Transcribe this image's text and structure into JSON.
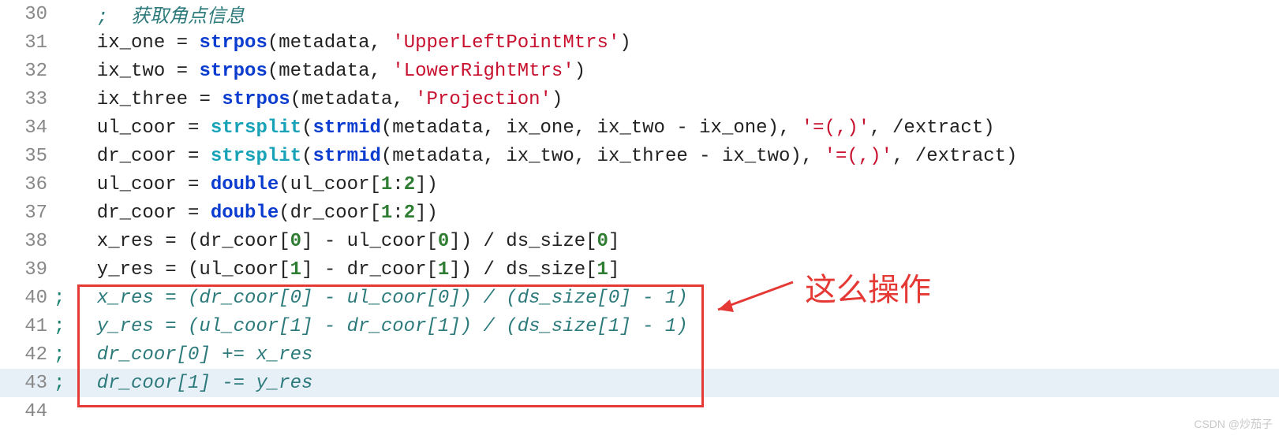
{
  "lines": [
    {
      "num": "30",
      "mod": "",
      "kind": "comment",
      "text": "  ;  获取角点信息"
    },
    {
      "num": "31",
      "mod": "",
      "kind": "code",
      "tokens": [
        {
          "t": "id",
          "v": "  ix_one "
        },
        {
          "t": "op",
          "v": "= "
        },
        {
          "t": "kw",
          "v": "strpos"
        },
        {
          "t": "op",
          "v": "(metadata, "
        },
        {
          "t": "str",
          "v": "'UpperLeftPointMtrs'"
        },
        {
          "t": "op",
          "v": ")"
        }
      ]
    },
    {
      "num": "32",
      "mod": "",
      "kind": "code",
      "tokens": [
        {
          "t": "id",
          "v": "  ix_two "
        },
        {
          "t": "op",
          "v": "= "
        },
        {
          "t": "kw",
          "v": "strpos"
        },
        {
          "t": "op",
          "v": "(metadata, "
        },
        {
          "t": "str",
          "v": "'LowerRightMtrs'"
        },
        {
          "t": "op",
          "v": ")"
        }
      ]
    },
    {
      "num": "33",
      "mod": "",
      "kind": "code",
      "tokens": [
        {
          "t": "id",
          "v": "  ix_three "
        },
        {
          "t": "op",
          "v": "= "
        },
        {
          "t": "kw",
          "v": "strpos"
        },
        {
          "t": "op",
          "v": "(metadata, "
        },
        {
          "t": "str",
          "v": "'Projection'"
        },
        {
          "t": "op",
          "v": ")"
        }
      ]
    },
    {
      "num": "34",
      "mod": "",
      "kind": "code",
      "tokens": [
        {
          "t": "id",
          "v": "  ul_coor "
        },
        {
          "t": "op",
          "v": "= "
        },
        {
          "t": "kw-cyan",
          "v": "strsplit"
        },
        {
          "t": "op",
          "v": "("
        },
        {
          "t": "kw",
          "v": "strmid"
        },
        {
          "t": "op",
          "v": "(metadata, ix_one, ix_two - ix_one), "
        },
        {
          "t": "str",
          "v": "'=(,)'"
        },
        {
          "t": "op",
          "v": ", /extract)"
        }
      ]
    },
    {
      "num": "35",
      "mod": "",
      "kind": "code",
      "tokens": [
        {
          "t": "id",
          "v": "  dr_coor "
        },
        {
          "t": "op",
          "v": "= "
        },
        {
          "t": "kw-cyan",
          "v": "strsplit"
        },
        {
          "t": "op",
          "v": "("
        },
        {
          "t": "kw",
          "v": "strmid"
        },
        {
          "t": "op",
          "v": "(metadata, ix_two, ix_three - ix_two), "
        },
        {
          "t": "str",
          "v": "'=(,)'"
        },
        {
          "t": "op",
          "v": ", /extract)"
        }
      ]
    },
    {
      "num": "36",
      "mod": "",
      "kind": "code",
      "tokens": [
        {
          "t": "id",
          "v": "  ul_coor "
        },
        {
          "t": "op",
          "v": "= "
        },
        {
          "t": "kw",
          "v": "double"
        },
        {
          "t": "op",
          "v": "(ul_coor["
        },
        {
          "t": "num",
          "v": "1"
        },
        {
          "t": "op",
          "v": ":"
        },
        {
          "t": "num",
          "v": "2"
        },
        {
          "t": "op",
          "v": "])"
        }
      ]
    },
    {
      "num": "37",
      "mod": "",
      "kind": "code",
      "tokens": [
        {
          "t": "id",
          "v": "  dr_coor "
        },
        {
          "t": "op",
          "v": "= "
        },
        {
          "t": "kw",
          "v": "double"
        },
        {
          "t": "op",
          "v": "(dr_coor["
        },
        {
          "t": "num",
          "v": "1"
        },
        {
          "t": "op",
          "v": ":"
        },
        {
          "t": "num",
          "v": "2"
        },
        {
          "t": "op",
          "v": "])"
        }
      ]
    },
    {
      "num": "38",
      "mod": "",
      "kind": "code",
      "tokens": [
        {
          "t": "id",
          "v": "  x_res "
        },
        {
          "t": "op",
          "v": "= (dr_coor["
        },
        {
          "t": "num",
          "v": "0"
        },
        {
          "t": "op",
          "v": "] - ul_coor["
        },
        {
          "t": "num",
          "v": "0"
        },
        {
          "t": "op",
          "v": "]) / ds_size["
        },
        {
          "t": "num",
          "v": "0"
        },
        {
          "t": "op",
          "v": "]"
        }
      ]
    },
    {
      "num": "39",
      "mod": "",
      "kind": "code",
      "tokens": [
        {
          "t": "id",
          "v": "  y_res "
        },
        {
          "t": "op",
          "v": "= (ul_coor["
        },
        {
          "t": "num",
          "v": "1"
        },
        {
          "t": "op",
          "v": "] - dr_coor["
        },
        {
          "t": "num",
          "v": "1"
        },
        {
          "t": "op",
          "v": "]) / ds_size["
        },
        {
          "t": "num",
          "v": "1"
        },
        {
          "t": "op",
          "v": "]"
        }
      ]
    },
    {
      "num": "40",
      "mod": ";",
      "kind": "comment-ital",
      "text": "  x_res = (dr_coor[0] - ul_coor[0]) / (ds_size[0] - 1)"
    },
    {
      "num": "41",
      "mod": ";",
      "kind": "comment-ital",
      "text": "  y_res = (ul_coor[1] - dr_coor[1]) / (ds_size[1] - 1)"
    },
    {
      "num": "42",
      "mod": ";",
      "kind": "comment-ital",
      "text": "  dr_coor[0] += x_res"
    },
    {
      "num": "43",
      "mod": ";",
      "kind": "comment-ital",
      "text": "  dr_coor[1] -= y_res",
      "current": true
    },
    {
      "num": "44",
      "mod": "",
      "kind": "code",
      "tokens": []
    }
  ],
  "annotation_text": "这么操作",
  "watermark": "CSDN @炒茄子"
}
